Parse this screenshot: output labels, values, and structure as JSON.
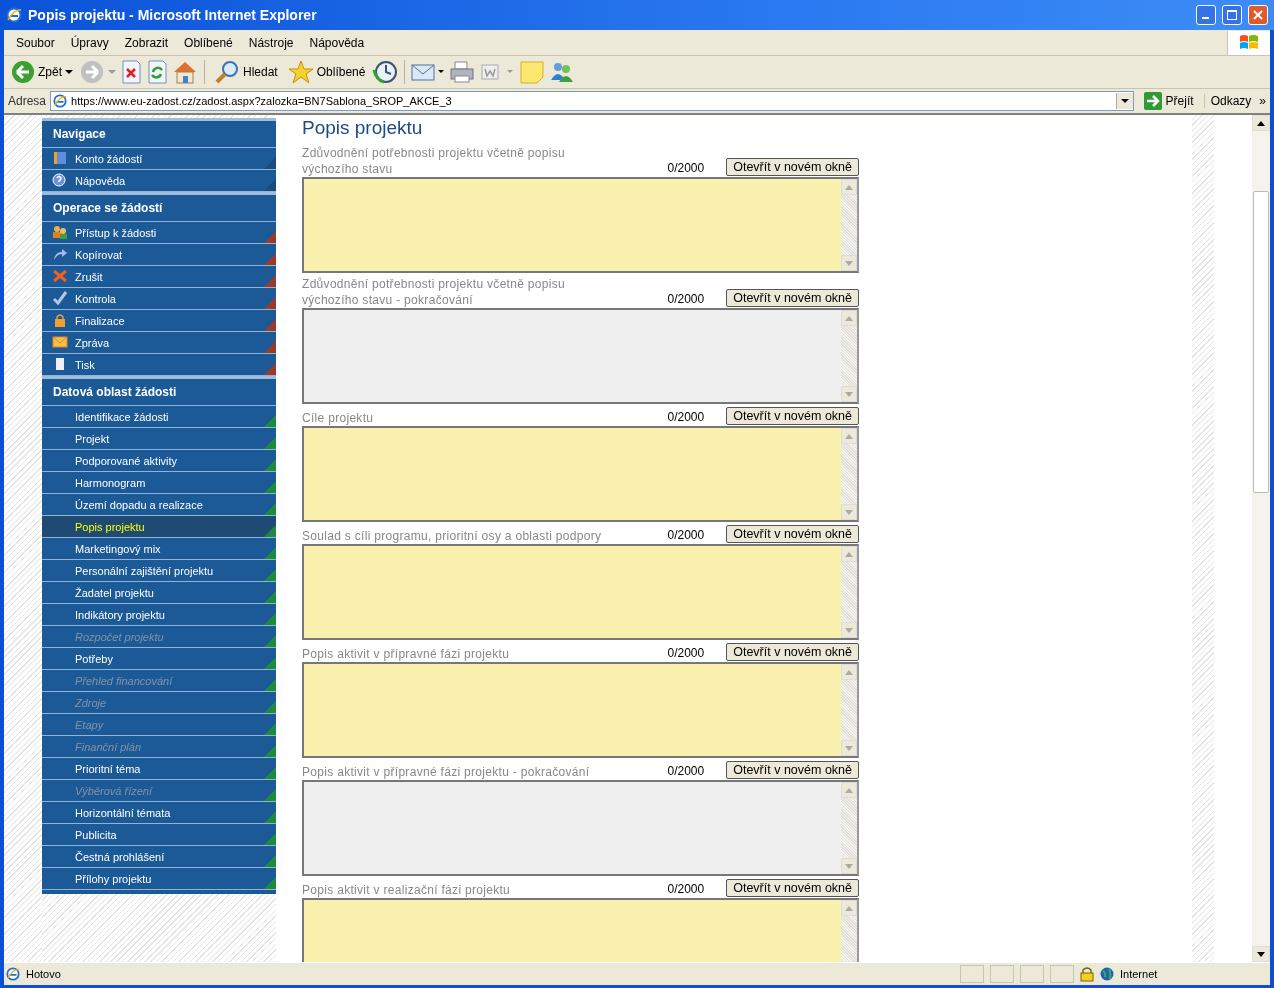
{
  "window": {
    "title": "Popis projektu - Microsoft Internet Explorer"
  },
  "menu": [
    "Soubor",
    "Úpravy",
    "Zobrazit",
    "Oblíbené",
    "Nástroje",
    "Nápověda"
  ],
  "toolbar": {
    "back": "Zpět",
    "search": "Hledat",
    "favorites": "Oblíbené"
  },
  "address_bar": {
    "label": "Adresa",
    "url": "https://www.eu-zadost.cz/zadost.aspx?zalozka=BN7Sablona_SROP_AKCE_3",
    "go": "Přejít",
    "links": "Odkazy",
    "more": "»"
  },
  "sidebar": {
    "sections": [
      {
        "title": "Navigace",
        "items": [
          {
            "label": "Konto žádostí",
            "color": "#1a4c80",
            "selected": false,
            "disabled": false
          },
          {
            "label": "Nápověda",
            "color": "#1a4c80",
            "selected": false,
            "disabled": false
          }
        ]
      },
      {
        "title": "Operace se žádostí",
        "items": [
          {
            "label": "Přístup k žádosti",
            "color": "#9c3a2a",
            "selected": false,
            "disabled": false
          },
          {
            "label": "Kopírovat",
            "color": "#9c3a2a",
            "selected": false,
            "disabled": false
          },
          {
            "label": "Zrušit",
            "color": "#9c3a2a",
            "selected": false,
            "disabled": false
          },
          {
            "label": "Kontrola",
            "color": "#9c3a2a",
            "selected": false,
            "disabled": false
          },
          {
            "label": "Finalizace",
            "color": "#9c3a2a",
            "selected": false,
            "disabled": false
          },
          {
            "label": "Zpráva",
            "color": "#9c3a2a",
            "selected": false,
            "disabled": false
          },
          {
            "label": "Tisk",
            "color": "#9c3a2a",
            "selected": false,
            "disabled": false
          }
        ]
      },
      {
        "title": "Datová oblast žádosti",
        "items": [
          {
            "label": "Identifikace žádosti",
            "color": "#1e8a3c",
            "selected": false,
            "disabled": false
          },
          {
            "label": "Projekt",
            "color": "#1e8a3c",
            "selected": false,
            "disabled": false
          },
          {
            "label": "Podporované aktivity",
            "color": "#1e8a3c",
            "selected": false,
            "disabled": false
          },
          {
            "label": "Harmonogram",
            "color": "#1e8a3c",
            "selected": false,
            "disabled": false
          },
          {
            "label": "Území dopadu a realizace",
            "color": "#1e8a3c",
            "selected": false,
            "disabled": false
          },
          {
            "label": "Popis projektu",
            "color": "#1e8a3c",
            "selected": true,
            "disabled": false
          },
          {
            "label": "Marketingový mix",
            "color": "#1e8a3c",
            "selected": false,
            "disabled": false
          },
          {
            "label": "Personální zajištění projektu",
            "color": "#1e8a3c",
            "selected": false,
            "disabled": false
          },
          {
            "label": "Žadatel projektu",
            "color": "#1e8a3c",
            "selected": false,
            "disabled": false
          },
          {
            "label": "Indikátory projektu",
            "color": "#1e8a3c",
            "selected": false,
            "disabled": false
          },
          {
            "label": "Rozpočet projektu",
            "color": "#1e8a3c",
            "selected": false,
            "disabled": true
          },
          {
            "label": "Potřeby",
            "color": "#1e8a3c",
            "selected": false,
            "disabled": false
          },
          {
            "label": "Přehled financování",
            "color": "#1e8a3c",
            "selected": false,
            "disabled": true
          },
          {
            "label": "Zdroje",
            "color": "#1e8a3c",
            "selected": false,
            "disabled": true
          },
          {
            "label": "Etapy",
            "color": "#1e8a3c",
            "selected": false,
            "disabled": true
          },
          {
            "label": "Finanční plán",
            "color": "#1e8a3c",
            "selected": false,
            "disabled": true
          },
          {
            "label": "Prioritní téma",
            "color": "#1e8a3c",
            "selected": false,
            "disabled": false
          },
          {
            "label": "Výběrová řízení",
            "color": "#1e8a3c",
            "selected": false,
            "disabled": true
          },
          {
            "label": "Horizontální témata",
            "color": "#1e8a3c",
            "selected": false,
            "disabled": false
          },
          {
            "label": "Publicita",
            "color": "#1e8a3c",
            "selected": false,
            "disabled": false
          },
          {
            "label": "Čestná prohlášení",
            "color": "#1e8a3c",
            "selected": false,
            "disabled": false
          },
          {
            "label": "Přílohy projektu",
            "color": "#1e8a3c",
            "selected": false,
            "disabled": false
          }
        ]
      }
    ]
  },
  "page": {
    "title": "Popis projektu",
    "fields": [
      {
        "label": "Zdůvodnění potřebnosti projektu včetně popisu výchozího stavu",
        "counter": "0/2000",
        "button": "Otevřít v novém okně",
        "disabled": false
      },
      {
        "label": "Zdůvodnění potřebnosti projektu včetně popisu výchozího stavu - pokračování",
        "counter": "0/2000",
        "button": "Otevřít v novém okně",
        "disabled": true
      },
      {
        "label": "Cíle projektu",
        "counter": "0/2000",
        "button": "Otevřít v novém okně",
        "disabled": false
      },
      {
        "label": "Soulad s cíli programu, prioritní osy a oblasti podpory",
        "counter": "0/2000",
        "button": "Otevřít v novém okně",
        "disabled": false
      },
      {
        "label": "Popis aktivit v přípravné fázi projektu",
        "counter": "0/2000",
        "button": "Otevřít v novém okně",
        "disabled": false
      },
      {
        "label": "Popis aktivit v přípravné fázi projektu - pokračování",
        "counter": "0/2000",
        "button": "Otevřít v novém okně",
        "disabled": true
      },
      {
        "label": "Popis aktivit v realizační fázi projektu",
        "counter": "0/2000",
        "button": "Otevřít v novém okně",
        "disabled": false
      }
    ]
  },
  "status_bar": {
    "text": "Hotovo",
    "zone": "Internet"
  }
}
